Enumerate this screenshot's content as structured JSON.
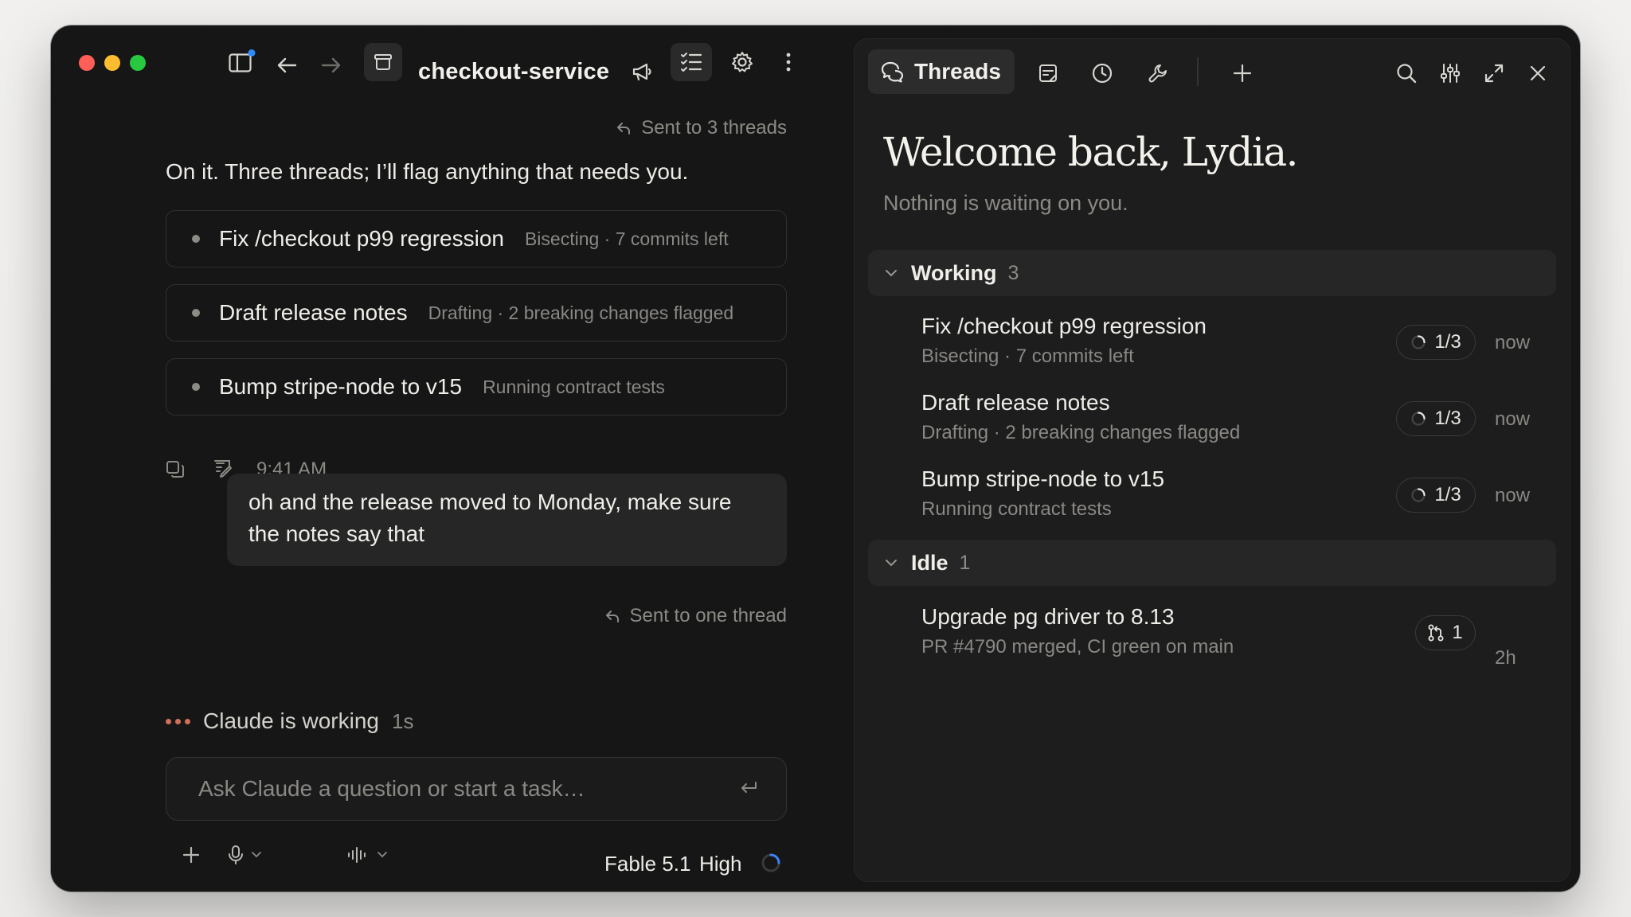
{
  "window": {
    "title": "checkout-service",
    "traffic_colors": [
      "#ff5f57",
      "#febc2e",
      "#28c840"
    ]
  },
  "left": {
    "sent_threads": "Sent to 3 threads",
    "lead_message": "On it. Three threads; I’ll flag anything that needs you.",
    "tasks": [
      {
        "name": "Fix /checkout p99 regression",
        "detail": "Bisecting · 7 commits left"
      },
      {
        "name": "Draft release notes",
        "detail": "Drafting · 2 breaking changes flagged"
      },
      {
        "name": "Bump stripe-node to v15",
        "detail": "Running contract tests"
      }
    ],
    "timestamp": "9:41 AM",
    "user_message": "oh and the release moved to Monday, make sure the notes say that",
    "sent_one": "Sent to one thread",
    "working_label": "Claude is working",
    "working_time": "1s",
    "working_dot_color": "#d0705a",
    "composer_placeholder": "Ask Claude a question or start a task…",
    "model": "Fable 5.1",
    "effort": "High"
  },
  "right": {
    "tab_label": "Threads",
    "welcome": "Welcome back, Lydia.",
    "subtitle": "Nothing is waiting on you.",
    "groups": [
      {
        "label": "Working",
        "count": "3",
        "threads": [
          {
            "title": "Fix /checkout p99 regression",
            "sub": "Bisecting · 7 commits left",
            "badge": "1/3",
            "time": "now"
          },
          {
            "title": "Draft release notes",
            "sub": "Drafting · 2 breaking changes flagged",
            "badge": "1/3",
            "time": "now"
          },
          {
            "title": "Bump stripe-node to v15",
            "sub": "Running contract tests",
            "badge": "1/3",
            "time": "now"
          }
        ]
      },
      {
        "label": "Idle",
        "count": "1",
        "threads": [
          {
            "title": "Upgrade pg driver to 8.13",
            "sub": "PR #4790 merged, CI green on main",
            "badge": "1",
            "time": "2h"
          }
        ]
      }
    ]
  },
  "icons": {
    "sidebar": "sidebar-toggle-icon",
    "back": "arrow-left-icon",
    "forward": "arrow-right-icon",
    "project": "folder-box-icon",
    "announce": "megaphone-icon",
    "tasks": "checklist-icon",
    "settings": "gear-icon",
    "more": "vertical-dots-icon",
    "threads": "chat-bubbles-icon",
    "note": "note-icon",
    "history": "clock-icon",
    "tools": "wrench-icon",
    "add": "plus-icon",
    "search": "search-icon",
    "filters": "sliders-icon",
    "expand": "expand-icon",
    "close": "close-icon"
  },
  "colors": {
    "accent_blue": "#2f8cff",
    "spinner_blue": "#3b82f6"
  }
}
